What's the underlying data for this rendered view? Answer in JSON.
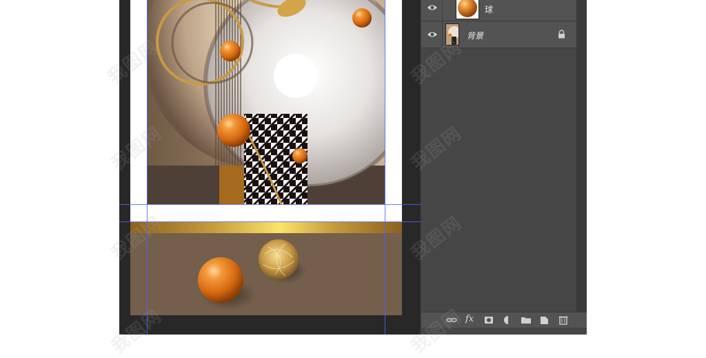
{
  "layers_panel": {
    "layers": [
      {
        "name": "球",
        "visible": true,
        "locked": false,
        "thumbnail": "orange-sphere"
      },
      {
        "name": "背景",
        "visible": true,
        "locked": true,
        "thumbnail": "background-art"
      }
    ],
    "footer_buttons": [
      "link-layers-icon",
      "fx-icon",
      "add-mask-icon",
      "adjustment-layer-icon",
      "new-group-icon",
      "new-layer-icon",
      "delete-layer-icon"
    ],
    "fx_label": "fx"
  },
  "watermark_text": "我图网",
  "colors": {
    "workspace": "#282828",
    "panel": "#464646",
    "layer_row": "#535353",
    "guide": "#4f63ff",
    "brown_panel": "#735f4c",
    "orange_sphere": "#e07a1c",
    "gold": "#fbe46a"
  }
}
